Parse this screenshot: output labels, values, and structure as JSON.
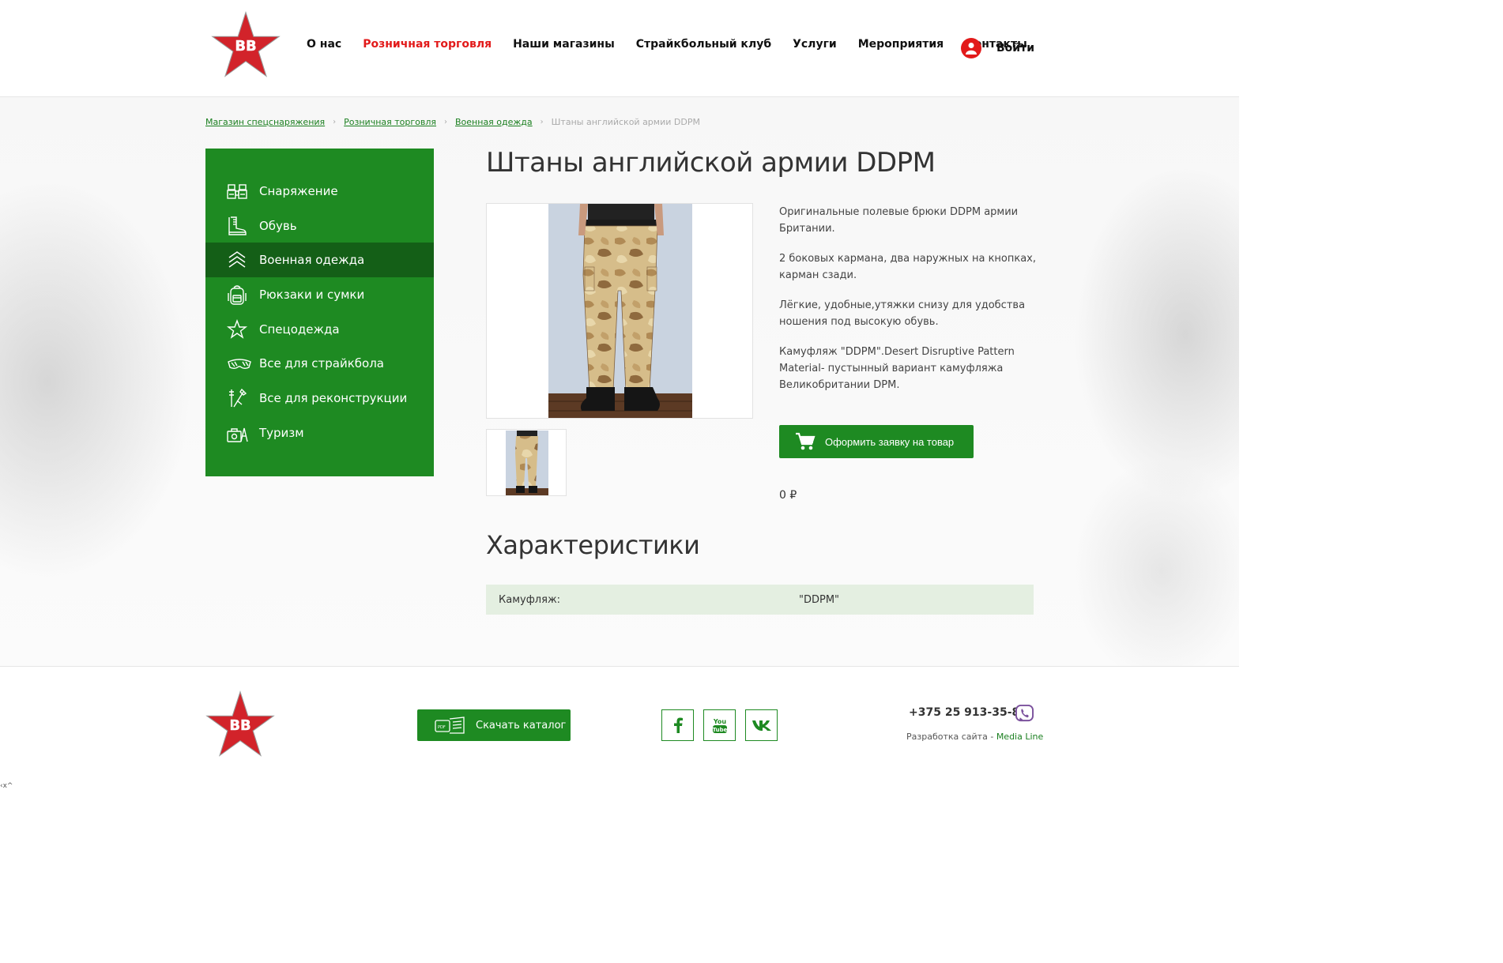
{
  "header": {
    "nav": [
      "О нас",
      "Розничная торговля",
      "Наши магазины",
      "Страйкбольный клуб",
      "Услуги",
      "Мероприятия",
      "Контакты"
    ],
    "active_nav": "Розничная торговля",
    "login_label": "Войти",
    "logo_text": "ВВ"
  },
  "breadcrumb": {
    "items": [
      "Магазин спецснаряжения",
      "Розничная торговля",
      "Военная одежда"
    ],
    "current": "Штаны английской армии DDPM"
  },
  "sidebar": {
    "items": [
      {
        "label": "Снаряжение",
        "icon": "binoculars-icon"
      },
      {
        "label": "Обувь",
        "icon": "boot-icon"
      },
      {
        "label": "Военная одежда",
        "icon": "chevron-rank-icon"
      },
      {
        "label": "Рюкзаки и сумки",
        "icon": "backpack-icon"
      },
      {
        "label": "Спецодежда",
        "icon": "star-icon"
      },
      {
        "label": "Все для страйкбола",
        "icon": "goggles-icon"
      },
      {
        "label": "Все для реконструкции",
        "icon": "tools-icon"
      },
      {
        "label": "Туризм",
        "icon": "camping-icon"
      }
    ],
    "active": "Военная одежда"
  },
  "product": {
    "title": "Штаны английской армии DDPM",
    "description": [
      "Оригинальные полевые брюки DDPM армии Британии.",
      "2 боковых кармана, два наружных на кнопках, карман сзади.",
      "Лёгкие, удобные,утяжки снизу для удобства ношения под высокую обувь.",
      "Камуфляж \"DDPM\".Desert Disruptive Pattern Material- пустынный вариант камуфляжа Великобритании DPM."
    ],
    "order_button": "Оформить заявку на товар",
    "price": "0 ₽"
  },
  "characteristics": {
    "title": "Характеристики",
    "rows": [
      {
        "key": "Камуфляж:",
        "value": "\"DDPM\""
      }
    ]
  },
  "footer": {
    "catalog_button": "Скачать каталог",
    "social": [
      "facebook-icon",
      "youtube-icon",
      "vk-icon"
    ],
    "phone": "+375 25 913-35-86",
    "dev_label": "Разработка сайта - ",
    "dev_company": "Media Line"
  },
  "corner_text": "‹x^",
  "colors": {
    "accent_red": "#e21a1a",
    "brand_green": "#1e8a22",
    "sidebar_active": "#145f17",
    "char_row_bg": "#e4efe1"
  }
}
